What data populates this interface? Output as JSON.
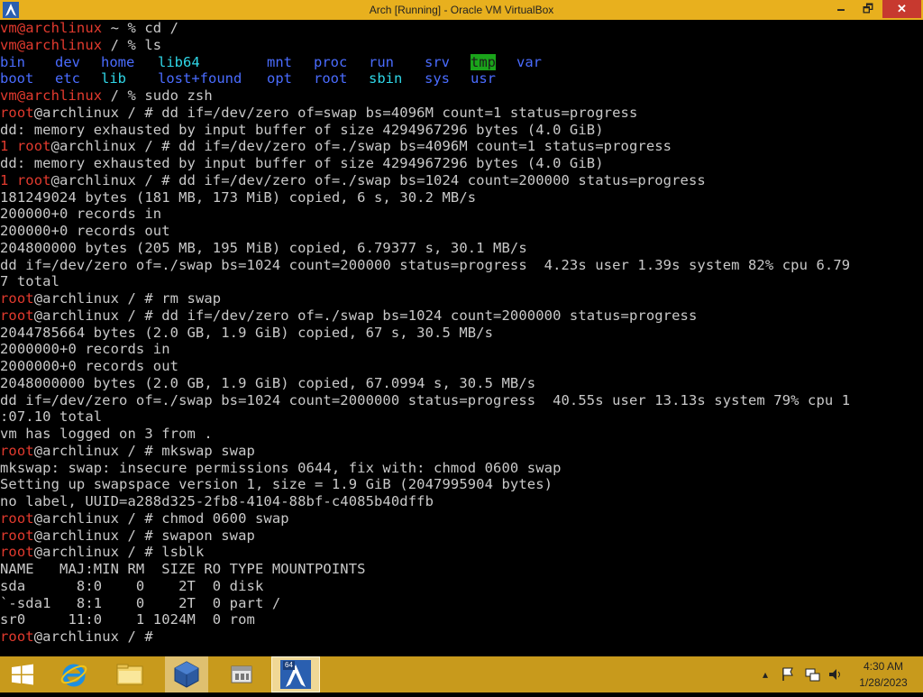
{
  "window": {
    "title": "Arch [Running] - Oracle VM VirtualBox",
    "minimize_icon": "minimize-icon",
    "maximize_icon": "restore-icon",
    "close_icon": "close-icon",
    "min_label": "🗕",
    "max_label": "🗗",
    "close_label": "✕"
  },
  "terminal": {
    "colors": {
      "prompt_root": "#e23a2e",
      "dir_blue": "#4a6cff",
      "dir_cyan": "#2fd7e8",
      "tmp_highlight": "#1aa41a",
      "text": "#c9c9c9"
    },
    "line1": {
      "user": "vm@archlinux",
      "rest": " ~ % cd /"
    },
    "line2": {
      "user": "vm@archlinux",
      "rest": " / % ls"
    },
    "ls_row1": [
      "bin",
      "dev",
      "home",
      "lib64",
      "mnt",
      "proc",
      "run",
      "srv",
      "tmp",
      "var"
    ],
    "ls_row2": [
      "boot",
      "etc",
      "lib",
      "lost+found",
      "opt",
      "root",
      "sbin",
      "sys",
      "usr"
    ],
    "line5": {
      "user": "vm@archlinux",
      "rest": " / % sudo zsh"
    },
    "line6": {
      "user": "root",
      "rest": "@archlinux / # dd if=/dev/zero of=swap bs=4096M count=1 status=progress"
    },
    "line7": "dd: memory exhausted by input buffer of size 4294967296 bytes (4.0 GiB)",
    "line8": {
      "user": "1 root",
      "rest": "@archlinux / # dd if=/dev/zero of=./swap bs=4096M count=1 status=progress"
    },
    "line9": "dd: memory exhausted by input buffer of size 4294967296 bytes (4.0 GiB)",
    "line10": {
      "user": "1 root",
      "rest": "@archlinux / # dd if=/dev/zero of=./swap bs=1024 count=200000 status=progress"
    },
    "line11": "181249024 bytes (181 MB, 173 MiB) copied, 6 s, 30.2 MB/s",
    "line12": "200000+0 records in",
    "line13": "200000+0 records out",
    "line14": "204800000 bytes (205 MB, 195 MiB) copied, 6.79377 s, 30.1 MB/s",
    "line15": "dd if=/dev/zero of=./swap bs=1024 count=200000 status=progress  4.23s user 1.39s system 82% cpu 6.79",
    "line16": "7 total",
    "line17": {
      "user": "root",
      "rest": "@archlinux / # rm swap"
    },
    "line18": {
      "user": "root",
      "rest": "@archlinux / # dd if=/dev/zero of=./swap bs=1024 count=2000000 status=progress"
    },
    "line19": "2044785664 bytes (2.0 GB, 1.9 GiB) copied, 67 s, 30.5 MB/s",
    "line20": "2000000+0 records in",
    "line21": "2000000+0 records out",
    "line22": "2048000000 bytes (2.0 GB, 1.9 GiB) copied, 67.0994 s, 30.5 MB/s",
    "line23": "dd if=/dev/zero of=./swap bs=1024 count=2000000 status=progress  40.55s user 13.13s system 79% cpu 1",
    "line24": ":07.10 total",
    "line25": "vm has logged on 3 from .",
    "line26": {
      "user": "root",
      "rest": "@archlinux / # mkswap swap"
    },
    "line27": "mkswap: swap: insecure permissions 0644, fix with: chmod 0600 swap",
    "line28": "Setting up swapspace version 1, size = 1.9 GiB (2047995904 bytes)",
    "line29": "no label, UUID=a288d325-2fb8-4104-88bf-c4085b40dffb",
    "line30": {
      "user": "root",
      "rest": "@archlinux / # chmod 0600 swap"
    },
    "line31": {
      "user": "root",
      "rest": "@archlinux / # swapon swap"
    },
    "line32": {
      "user": "root",
      "rest": "@archlinux / # lsblk"
    },
    "line33": "NAME   MAJ:MIN RM  SIZE RO TYPE MOUNTPOINTS",
    "line34": "sda      8:0    0    2T  0 disk",
    "line35": "`-sda1   8:1    0    2T  0 part /",
    "line36": "sr0     11:0    1 1024M  0 rom",
    "line37": {
      "user": "root",
      "rest": "@archlinux / # "
    }
  },
  "taskbar": {
    "clock_time": "4:30 AM",
    "clock_date": "1/28/2023",
    "items": [
      "windows-start-icon",
      "internet-explorer-icon",
      "file-explorer-icon",
      "virtualbox-icon",
      "app-icon",
      "arch-linux-icon"
    ],
    "tray_icons": [
      "show-hidden-icons-icon",
      "action-center-flag-icon",
      "network-icon",
      "volume-icon"
    ],
    "arch_badge": "64"
  }
}
